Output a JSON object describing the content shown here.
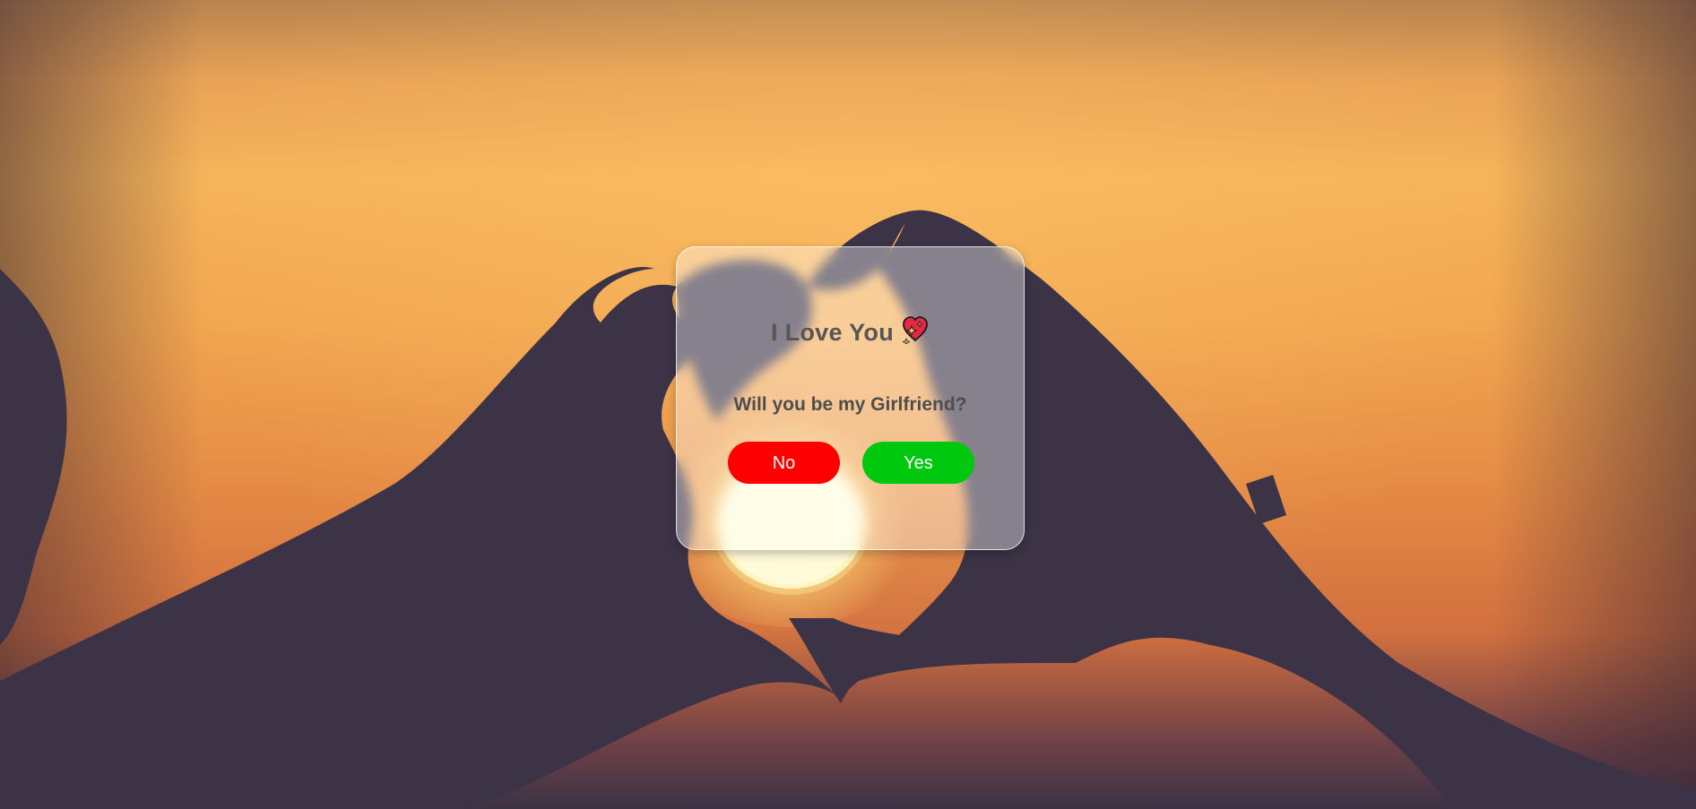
{
  "card": {
    "title": "I Love You",
    "title_icon": "sparkling-heart-icon",
    "question": "Will you be my Girlfriend?",
    "no_label": "No",
    "yes_label": "Yes"
  },
  "colors": {
    "no_button": "#ff0000",
    "yes_button": "#00c80e",
    "text": "#565656",
    "sky_top": "#f6b45a",
    "hands_silhouette": "#3c3446"
  }
}
